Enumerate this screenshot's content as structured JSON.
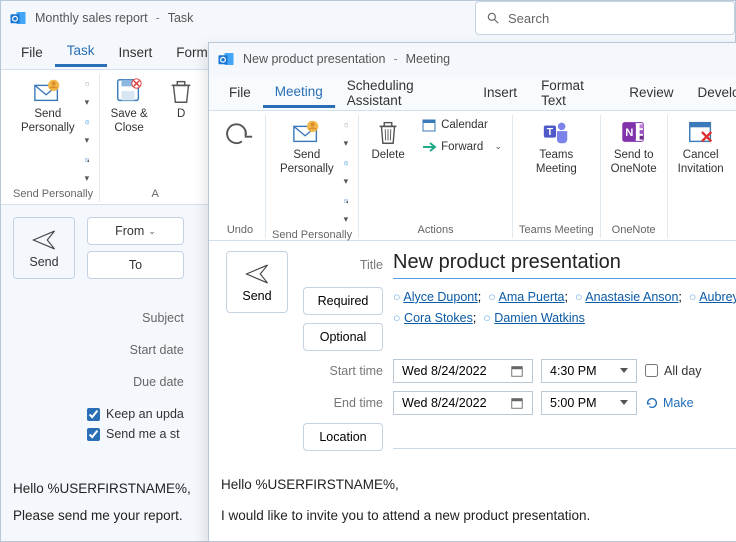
{
  "back": {
    "title_doc": "Monthly sales report",
    "title_type": "Task",
    "menu": {
      "file": "File",
      "task": "Task",
      "insert": "Insert",
      "format": "Form"
    },
    "ribbon": {
      "send_personally": "Send\nPersonally",
      "save_close": "Save &\nClose",
      "group_send": "Send Personally",
      "group_ac": "A"
    },
    "buttons": {
      "send": "Send",
      "from": "From",
      "to": "To"
    },
    "labels": {
      "subject": "Subject",
      "start": "Start date",
      "due": "Due date"
    },
    "checks": {
      "keep": "Keep an upda",
      "sendme": "Send me a st"
    },
    "body_l1": "Hello %USERFIRSTNAME%,",
    "body_l2": "Please send me your report."
  },
  "search_placeholder": "Search",
  "front": {
    "title_doc": "New product presentation",
    "title_type": "Meeting",
    "menu": {
      "file": "File",
      "meeting": "Meeting",
      "sched": "Scheduling Assistant",
      "insert": "Insert",
      "format": "Format Text",
      "review": "Review",
      "dev": "Develop"
    },
    "ribbon": {
      "undo": "Undo",
      "send_personally": "Send\nPersonally",
      "delete": "Delete",
      "calendar": "Calendar",
      "forward": "Forward",
      "teams": "Teams\nMeeting",
      "onenote": "Send to\nOneNote",
      "cancel": "Cancel\nInvitation",
      "group_send": "Send Personally",
      "group_actions": "Actions",
      "group_teams": "Teams Meeting",
      "group_onenote": "OneNote"
    },
    "labels": {
      "title": "Title",
      "required": "Required",
      "optional": "Optional",
      "start": "Start time",
      "end": "End time",
      "location": "Location",
      "send": "Send",
      "allday": "All day",
      "make": "Make"
    },
    "title_value": "New product presentation",
    "attendees": {
      "a1": "Alyce Dupont",
      "a2": "Ama Puerta",
      "a3": "Anastasie Anson",
      "a4": "Aubrey",
      "a5": "Cora Stokes",
      "a6": "Damien Watkins"
    },
    "start_date": "Wed 8/24/2022",
    "start_time": "4:30 PM",
    "end_date": "Wed 8/24/2022",
    "end_time": "5:00 PM",
    "body_l1": "Hello %USERFIRSTNAME%,",
    "body_l2": "I would like to invite you to attend a new product presentation."
  }
}
